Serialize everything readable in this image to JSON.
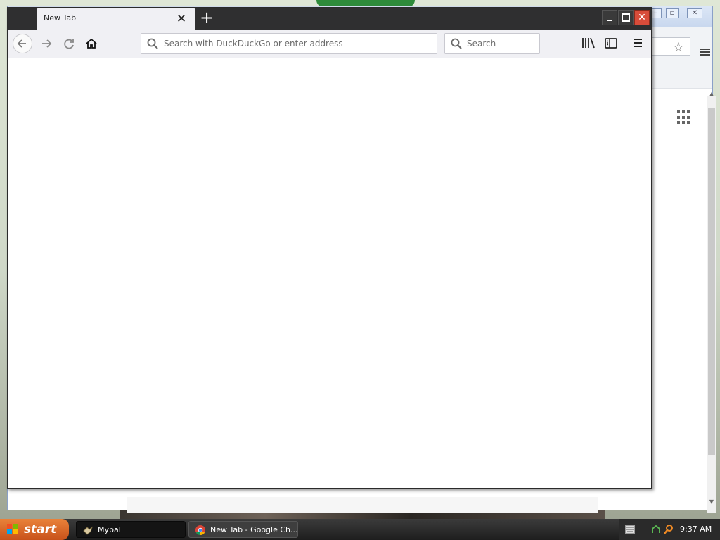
{
  "firefox": {
    "tab_title": "New Tab",
    "address_placeholder": "Search with DuckDuckGo or enter address",
    "search_placeholder": "Search"
  },
  "taskbar": {
    "start_label": "start",
    "items": [
      {
        "label": "Mypal"
      },
      {
        "label": "New Tab - Google Ch..."
      }
    ],
    "clock": "9:37 AM"
  }
}
